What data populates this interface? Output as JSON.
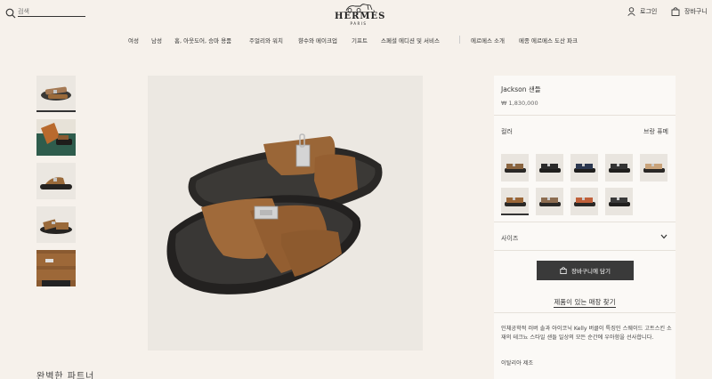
{
  "header": {
    "search_placeholder": "검색",
    "logo_text": "HERMÈS",
    "logo_sub": "PARIS",
    "login_label": "로그인",
    "cart_label": "장바구니"
  },
  "nav": {
    "items": [
      "여성",
      "남성",
      "홈, 아웃도어, 승마 용품",
      "주얼리와 워치",
      "향수와 메이크업",
      "기프트",
      "스페셜 에디션 및 서비스",
      "에르메스 소개",
      "메종 에르메스 도산 파크"
    ]
  },
  "gallery": {
    "section_title": "완벽한 파트너"
  },
  "product": {
    "name": "Jackson 샌들",
    "price": "₩ 1,830,000",
    "color_label": "컬러",
    "selected_color": "브랑 퓨메",
    "size_label": "사이즈",
    "add_to_cart": "장바구니에 담기",
    "store_link": "제품이 있는 매장 찾기",
    "description": "인체공학적 러버 솔과 아이코닉 Kelly 버클이 특징인 스웨이드 고트스킨 소재의 테크뇨 스타일 샌들 일상의 모든 순간에 우아함을 선사합니다.",
    "origin": "이탈리아 제조"
  },
  "colors": {
    "accent": "#3a3a3a",
    "background": "#f6f1eb",
    "suede_brown": "#9a6a3a"
  }
}
